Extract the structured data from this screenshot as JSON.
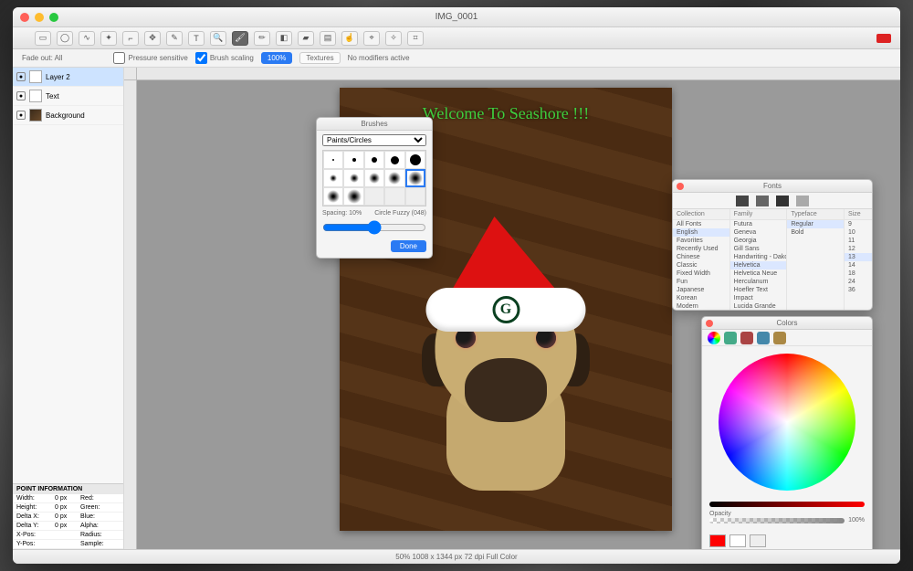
{
  "window": {
    "title": "IMG_0001"
  },
  "toolbar_tools": [
    "rect-select",
    "ellipse-select",
    "lasso",
    "wand",
    "crop",
    "move",
    "eyedropper",
    "text",
    "zoom",
    "brush",
    "pencil",
    "eraser",
    "bucket",
    "gradient",
    "smudge",
    "clone",
    "effect",
    "position"
  ],
  "toolbar_active": "brush",
  "options": {
    "fade_label": "Fade out: All",
    "pressure_label": "Pressure sensitive",
    "brush_scaling_label": "Brush scaling",
    "scaling_seg": "100%",
    "textures_label": "Textures",
    "modifier_label": "No modifiers active"
  },
  "layers": [
    {
      "name": "Layer 2",
      "selected": true
    },
    {
      "name": "Text",
      "selected": false
    },
    {
      "name": "Background",
      "selected": false
    }
  ],
  "point_info": {
    "header": "POINT INFORMATION",
    "rows": [
      [
        "Width:",
        "0 px",
        "Red:"
      ],
      [
        "Height:",
        "0 px",
        "Green:"
      ],
      [
        "Delta X:",
        "0 px",
        "Blue:"
      ],
      [
        "Delta Y:",
        "0 px",
        "Alpha:"
      ],
      [
        "X-Pos:",
        "",
        "Radius:"
      ],
      [
        "Y-Pos:",
        "",
        "Sample:"
      ]
    ]
  },
  "canvas": {
    "headline": "Welcome To Seashore !!!",
    "hat_logo": "G"
  },
  "brush_panel": {
    "title": "Brushes",
    "group": "Paints/Circles",
    "spacing_label": "Spacing: 10%",
    "active_label": "Circle Fuzzy (048)",
    "done": "Done"
  },
  "fonts_panel": {
    "title": "Fonts",
    "col_headers": [
      "Collection",
      "Family",
      "Typeface",
      "Size"
    ],
    "collections": [
      "All Fonts",
      "English",
      "Favorites",
      "Recently Used",
      "Chinese",
      "Classic",
      "Fixed Width",
      "Fun",
      "Japanese",
      "Korean",
      "Modern"
    ],
    "collections_sel": "English",
    "families": [
      "Futura",
      "Geneva",
      "Georgia",
      "Gill Sans",
      "Handwriting - Dako",
      "Helvetica",
      "Helvetica Neue",
      "Herculanum",
      "Hoefler Text",
      "Impact",
      "Lucida Grande"
    ],
    "families_sel": "Helvetica",
    "typefaces": [
      "Regular",
      "Bold"
    ],
    "typefaces_sel": "Regular",
    "sizes": [
      "9",
      "10",
      "11",
      "12",
      "13",
      "14",
      "18",
      "24",
      "36"
    ],
    "size_value": "13"
  },
  "color_panel": {
    "title": "Colors",
    "opacity_label": "Opacity",
    "opacity_value": "100%",
    "swatch_color": "#ff0000"
  },
  "status": "50%   1008 x 1344 px   72 dpi   Full Color"
}
